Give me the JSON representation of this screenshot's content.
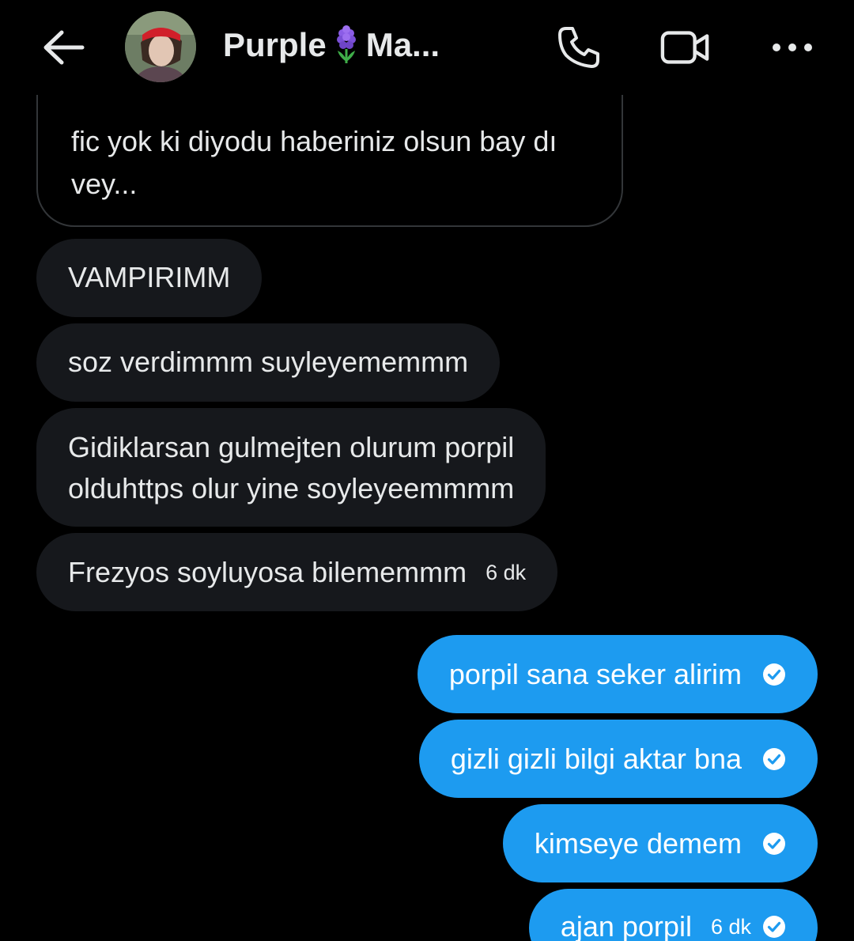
{
  "header": {
    "title": "Purple",
    "title_suffix": "Ma...",
    "back_icon": "arrow-left-icon",
    "call_icon": "phone-icon",
    "video_icon": "video-icon",
    "more_icon": "more-horizontal-icon"
  },
  "colors": {
    "background": "#000000",
    "incoming_bubble": "#16181c",
    "outgoing_bubble": "#1d9bf0",
    "text": "#e7e9ea"
  },
  "quoted_message": {
    "line1": "fic yok ki diyodu haberiniz olsun bay dı",
    "line2": "vey..."
  },
  "incoming": [
    {
      "text": "VAMPIRIMM"
    },
    {
      "text": "soz verdimmm suyleyememmm"
    },
    {
      "line1": "Gidiklarsan gulmejten olurum porpil",
      "line2": "olduhttps olur yine soyleyeemmmm"
    },
    {
      "text": "Frezyos soyluyosa bilememmm",
      "time": "6 dk"
    }
  ],
  "outgoing": [
    {
      "text": "porpil sana seker alirim"
    },
    {
      "text": "gizli gizli bilgi aktar bna"
    },
    {
      "text": "kimseye demem"
    },
    {
      "text": "ajan porpil",
      "time": "6 dk"
    }
  ]
}
